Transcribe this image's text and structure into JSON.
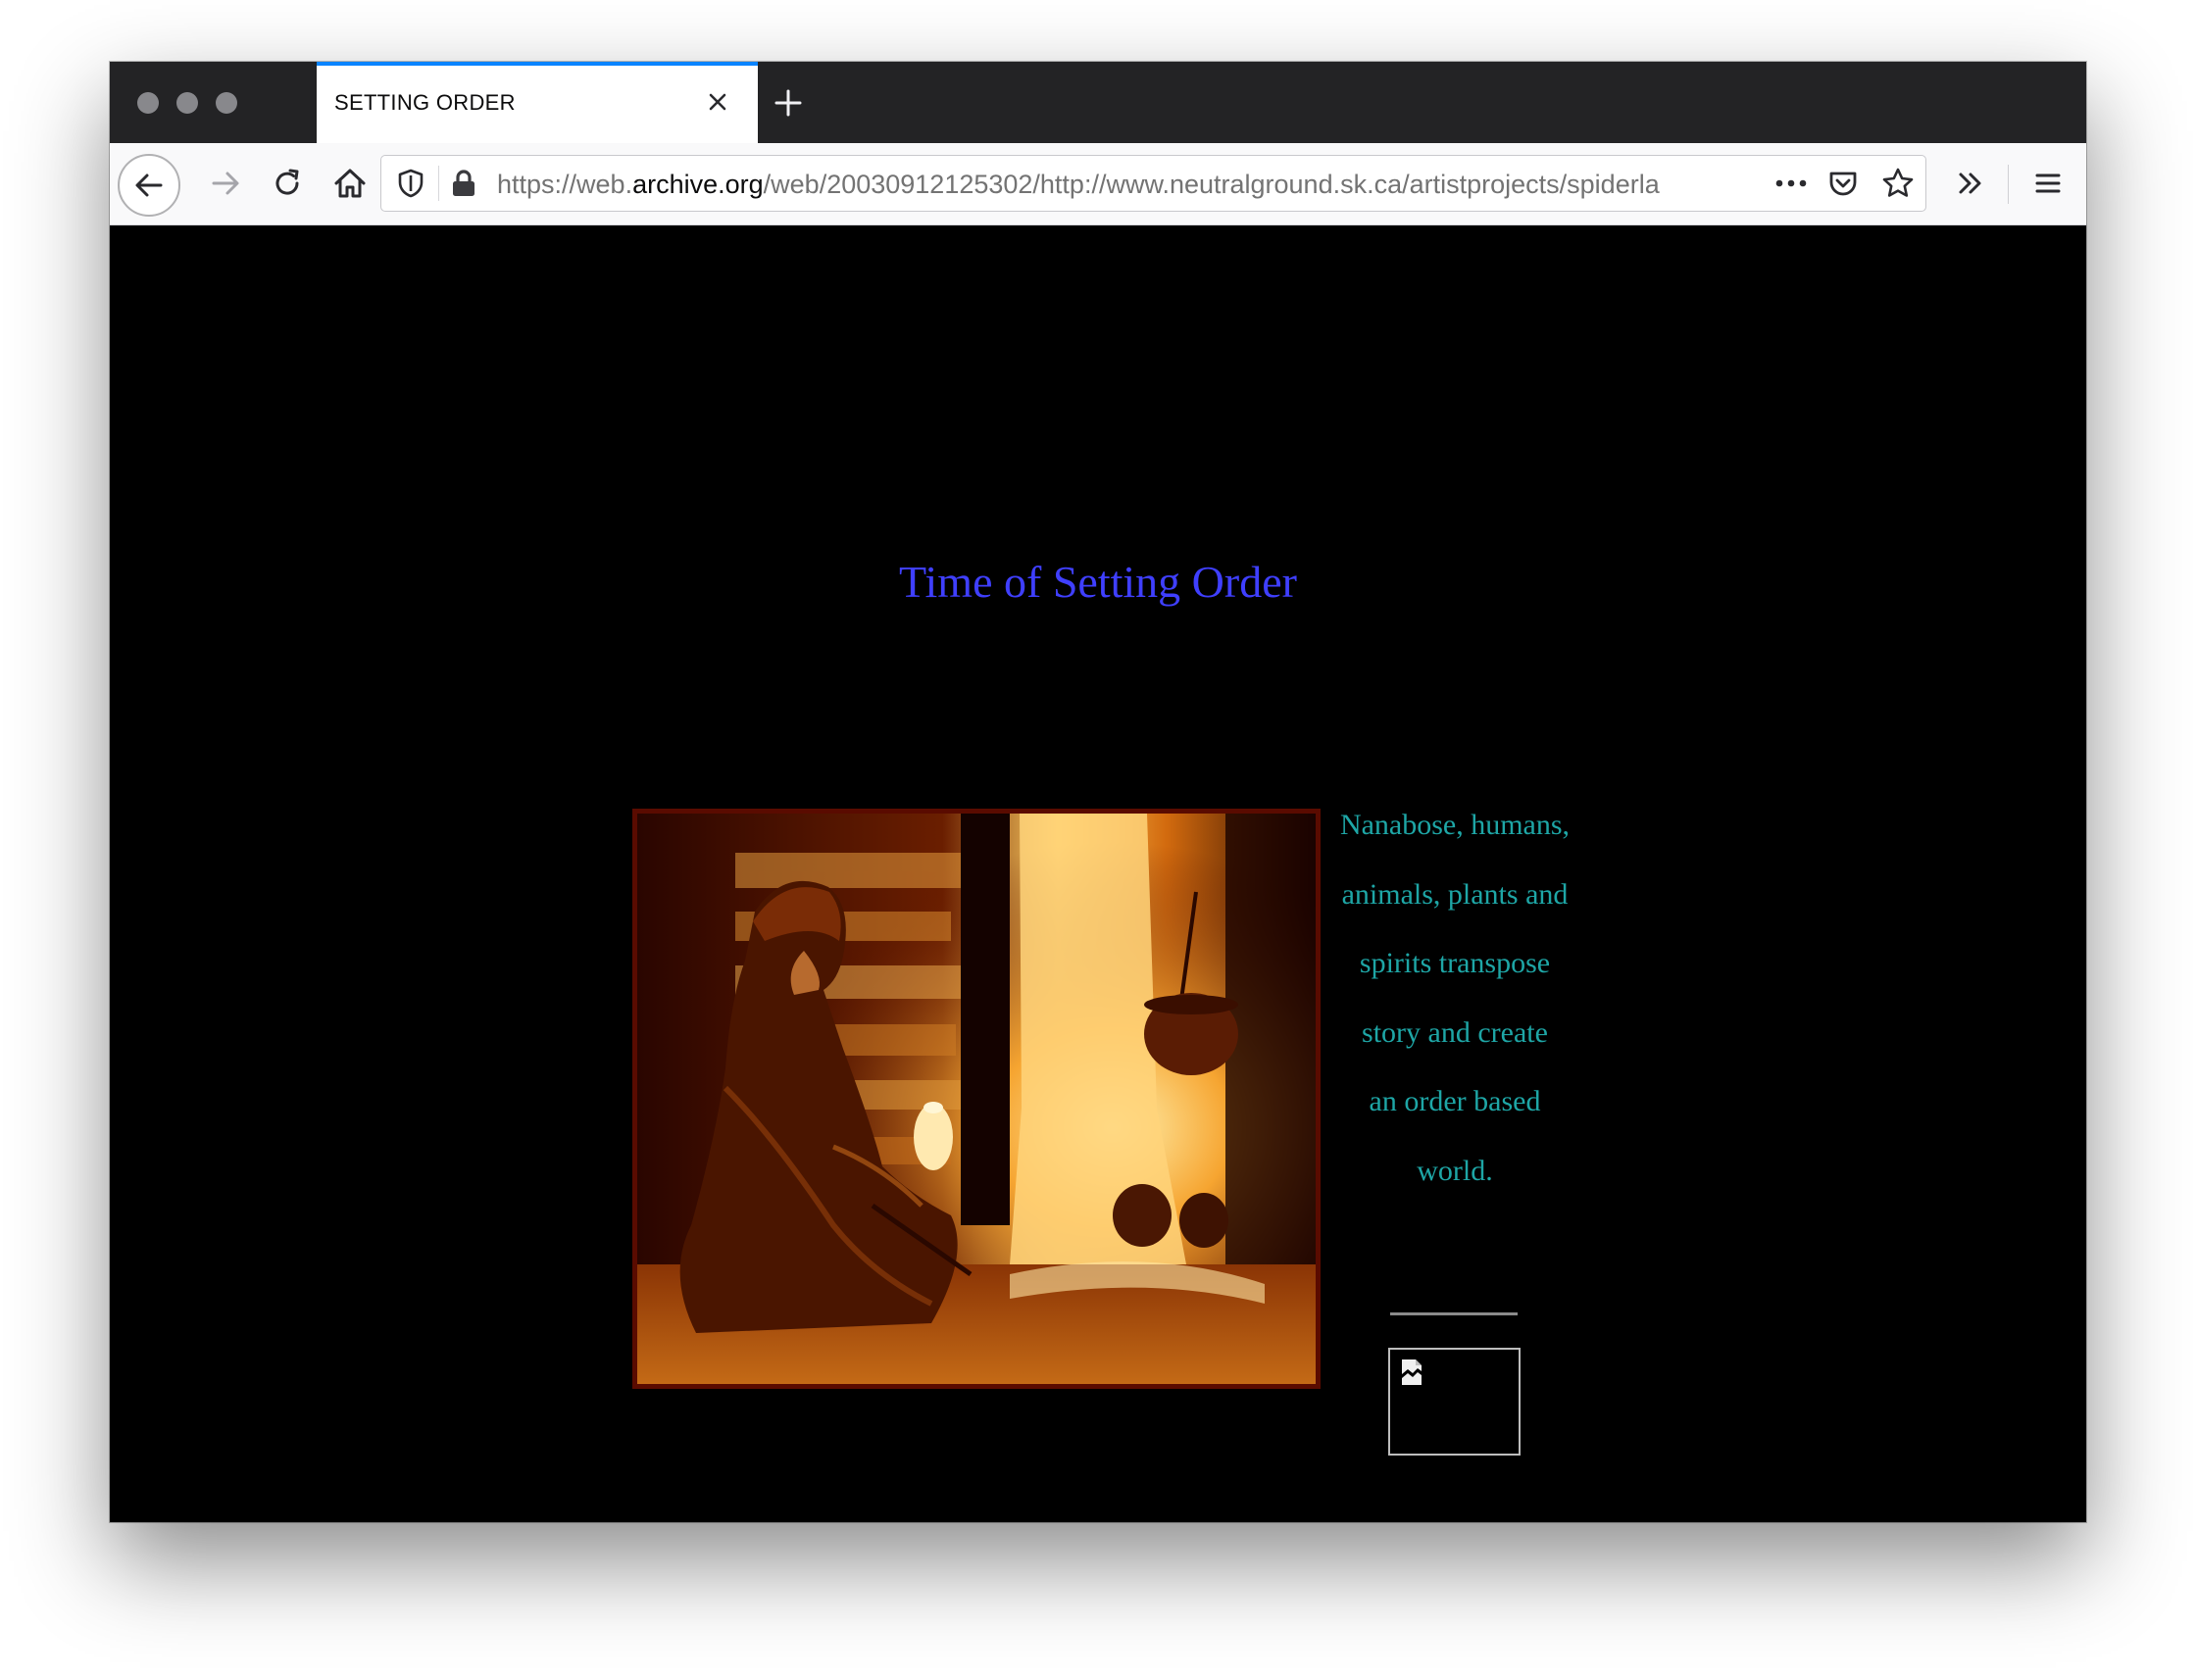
{
  "browser": {
    "tab": {
      "title": "SETTING ORDER"
    },
    "url": {
      "prefix": "https://web.",
      "host": "archive.org",
      "rest": "/web/20030912125302/http://www.neutralground.sk.ca/artistprojects/spiderla"
    }
  },
  "page": {
    "heading": "Time of Setting Order",
    "poem_lines": [
      "Nanabose, humans,",
      "animals, plants and",
      "spirits transpose",
      "story and create",
      "an order based",
      "world."
    ]
  },
  "icons": {
    "close": "close-icon",
    "new_tab": "plus-icon",
    "back": "arrow-left-icon",
    "forward": "arrow-right-icon",
    "reload": "reload-icon",
    "home": "home-icon",
    "tracking": "shield-icon",
    "lock": "lock-icon",
    "page_actions": "more-icon",
    "pocket": "pocket-icon",
    "bookmark": "star-icon",
    "overflow": "chevron-double-right-icon",
    "menu": "hamburger-menu-icon",
    "broken_image": "broken-image-icon"
  },
  "colors": {
    "page_background": "#000000",
    "heading": "#3f3fff",
    "poem_text": "#1ea6a6",
    "tab_accent": "#0a84ff",
    "photo_border": "#5a0b00"
  }
}
